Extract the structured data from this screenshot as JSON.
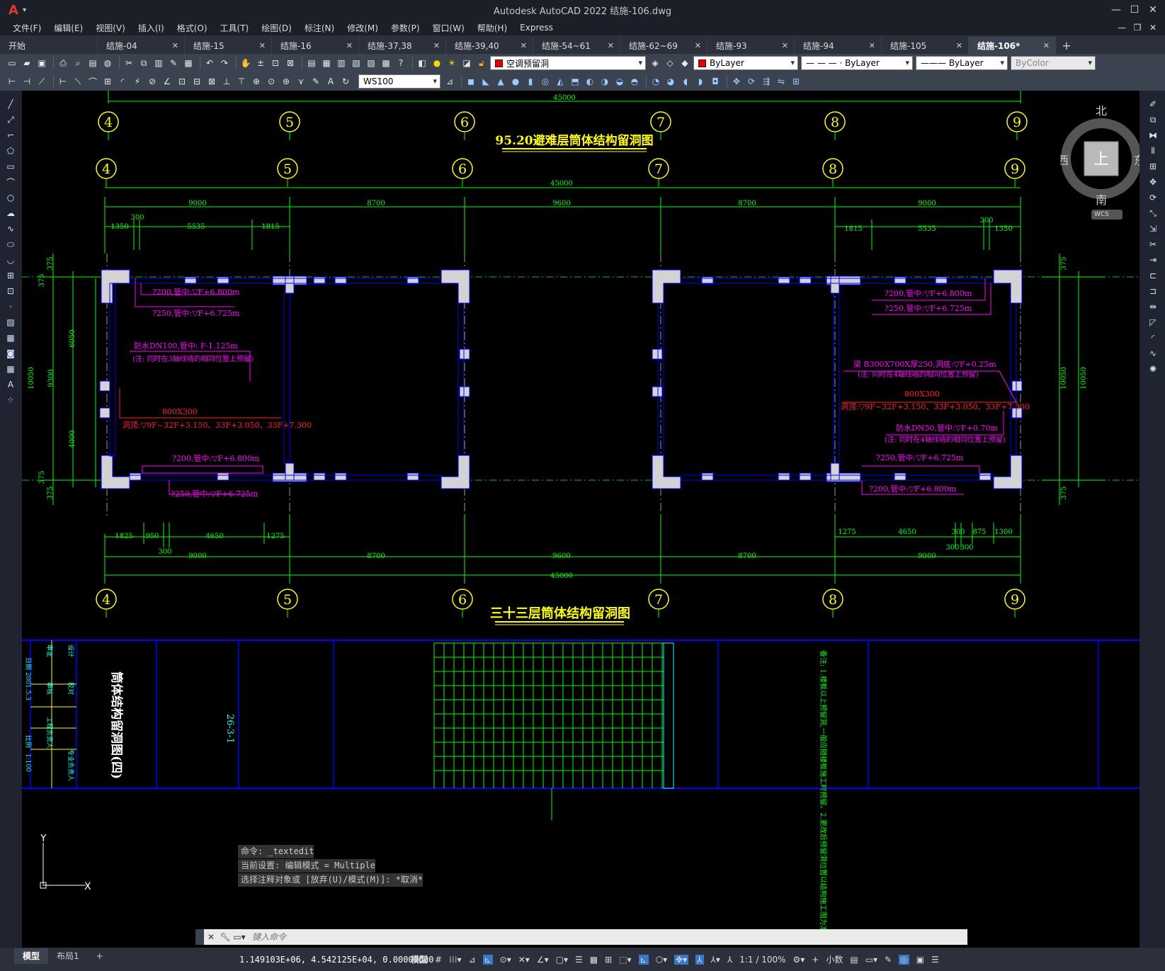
{
  "app": {
    "title": "Autodesk AutoCAD 2022    结施-106.dwg",
    "logo": "A"
  },
  "menu": [
    "文件(F)",
    "编辑(E)",
    "视图(V)",
    "插入(I)",
    "格式(O)",
    "工具(T)",
    "绘图(D)",
    "标注(N)",
    "修改(M)",
    "参数(P)",
    "窗口(W)",
    "帮助(H)",
    "Express"
  ],
  "tabs": [
    {
      "label": "开始",
      "active": false
    },
    {
      "label": "结施-04",
      "active": false
    },
    {
      "label": "结施-15",
      "active": false
    },
    {
      "label": "结施-16",
      "active": false
    },
    {
      "label": "结施-37,38",
      "active": false
    },
    {
      "label": "结施-39,40",
      "active": false
    },
    {
      "label": "结施-54~61",
      "active": false
    },
    {
      "label": "结施-62~69",
      "active": false
    },
    {
      "label": "结施-93",
      "active": false
    },
    {
      "label": "结施-94",
      "active": false
    },
    {
      "label": "结施-105",
      "active": false
    },
    {
      "label": "结施-106*",
      "active": true
    }
  ],
  "toolbar": {
    "layer": "空调预留洞",
    "color": "ByLayer",
    "linetype": "— — — · ByLayer",
    "lineweight": "——— ByLayer",
    "plotstyle": "ByColor",
    "textstyle": "WS100"
  },
  "drawing": {
    "title_top": "95.20避难层筒体结构留洞图",
    "title_bottom": "三十三层筒体结构留洞图",
    "axes": [
      "4",
      "5",
      "6",
      "7",
      "8",
      "9"
    ],
    "dim_total": "45000",
    "dims_main": [
      "9000",
      "8700",
      "9600",
      "8700",
      "9000"
    ],
    "dims_left_top": [
      "1350",
      "300",
      "5535",
      "1815"
    ],
    "dims_right_top": [
      "1815",
      "5535",
      "300",
      "1350"
    ],
    "dims_left_bottom": [
      "1825",
      "950",
      "300",
      "4650",
      "1275"
    ],
    "dims_right_bottom": [
      "1275",
      "4650",
      "300",
      "875",
      "1300",
      "300",
      "300"
    ],
    "dims_vertical_left": [
      "375",
      "375",
      "6050",
      "10050",
      "9300",
      "4000",
      "375",
      "375"
    ],
    "dims_vertical_right": [
      "375",
      "10050",
      "10050",
      "375"
    ],
    "notes_left": [
      "?200,管中:▽F+6.800m",
      "?250,管中:▽F+6.725m",
      "防水DN100,管中: F-1.125m",
      "(注: 同时在3轴线墙的相同位置上预留)",
      "800X300",
      "洞顶:▽9F~32F+3.150、33F+3.050、33F+7.300",
      "?200,管中:▽F+6.800m",
      "?250,管中:▽F+6.725m"
    ],
    "notes_right": [
      "?200,管中:▽F+6.800m",
      "?250,管中:▽F+6.725m",
      "梁 B300X700X厚250,洞底:▽F+0.25m",
      "(注: 同时在4轴线墙的相同位置上预留)",
      "800X300",
      "洞顶:▽9F~32F+3.150、33F+3.050、33F+7.300",
      "防水DN50,管中:▽F+0.70m",
      "(注: 同时在4轴线墙的相同位置上预留)",
      "?250,管中:▽F+6.725m",
      "?200,管中:▽F+6.800m"
    ],
    "titleblock": {
      "drawing_name": "筒体结构留洞图(四)",
      "project_no": "26-3-1",
      "labels": [
        "审定",
        "审核",
        "设计",
        "校对",
        "工程负责人",
        "专业负责人",
        "比例",
        "1:100",
        "日期",
        "2001.5.3"
      ],
      "left_note": "日期 2001.5.3",
      "right_note": "备注: 1.楼板以上预留洞,一般应随楼板施工时预留。2.更改后预留洞位置以结构施工图为准。"
    }
  },
  "viewcube": {
    "n": "北",
    "s": "南",
    "e": "东",
    "w": "西",
    "top": "上",
    "wcs": "WCS"
  },
  "command": {
    "history": [
      "命令: _textedit",
      "当前设置: 编辑模式 = Multiple",
      "选择注释对象或 [放弃(U)/模式(M)]: *取消*"
    ],
    "placeholder": "键入命令"
  },
  "layouts": [
    "模型",
    "布局1",
    "+"
  ],
  "status": {
    "coords": "1.149103E+06, 4.542125E+04, 0.00000000",
    "model": "模型",
    "scale": "1:1 / 100%",
    "units": "小数"
  },
  "ucs": {
    "y": "Y",
    "x": "X"
  },
  "colors": {
    "green": "#00ff00",
    "yellow": "#ffff00",
    "magenta": "#ff00ff",
    "red": "#ff2020",
    "blue": "#0000ff",
    "wall": "#d0d0d0",
    "cyan": "#00ffff"
  }
}
